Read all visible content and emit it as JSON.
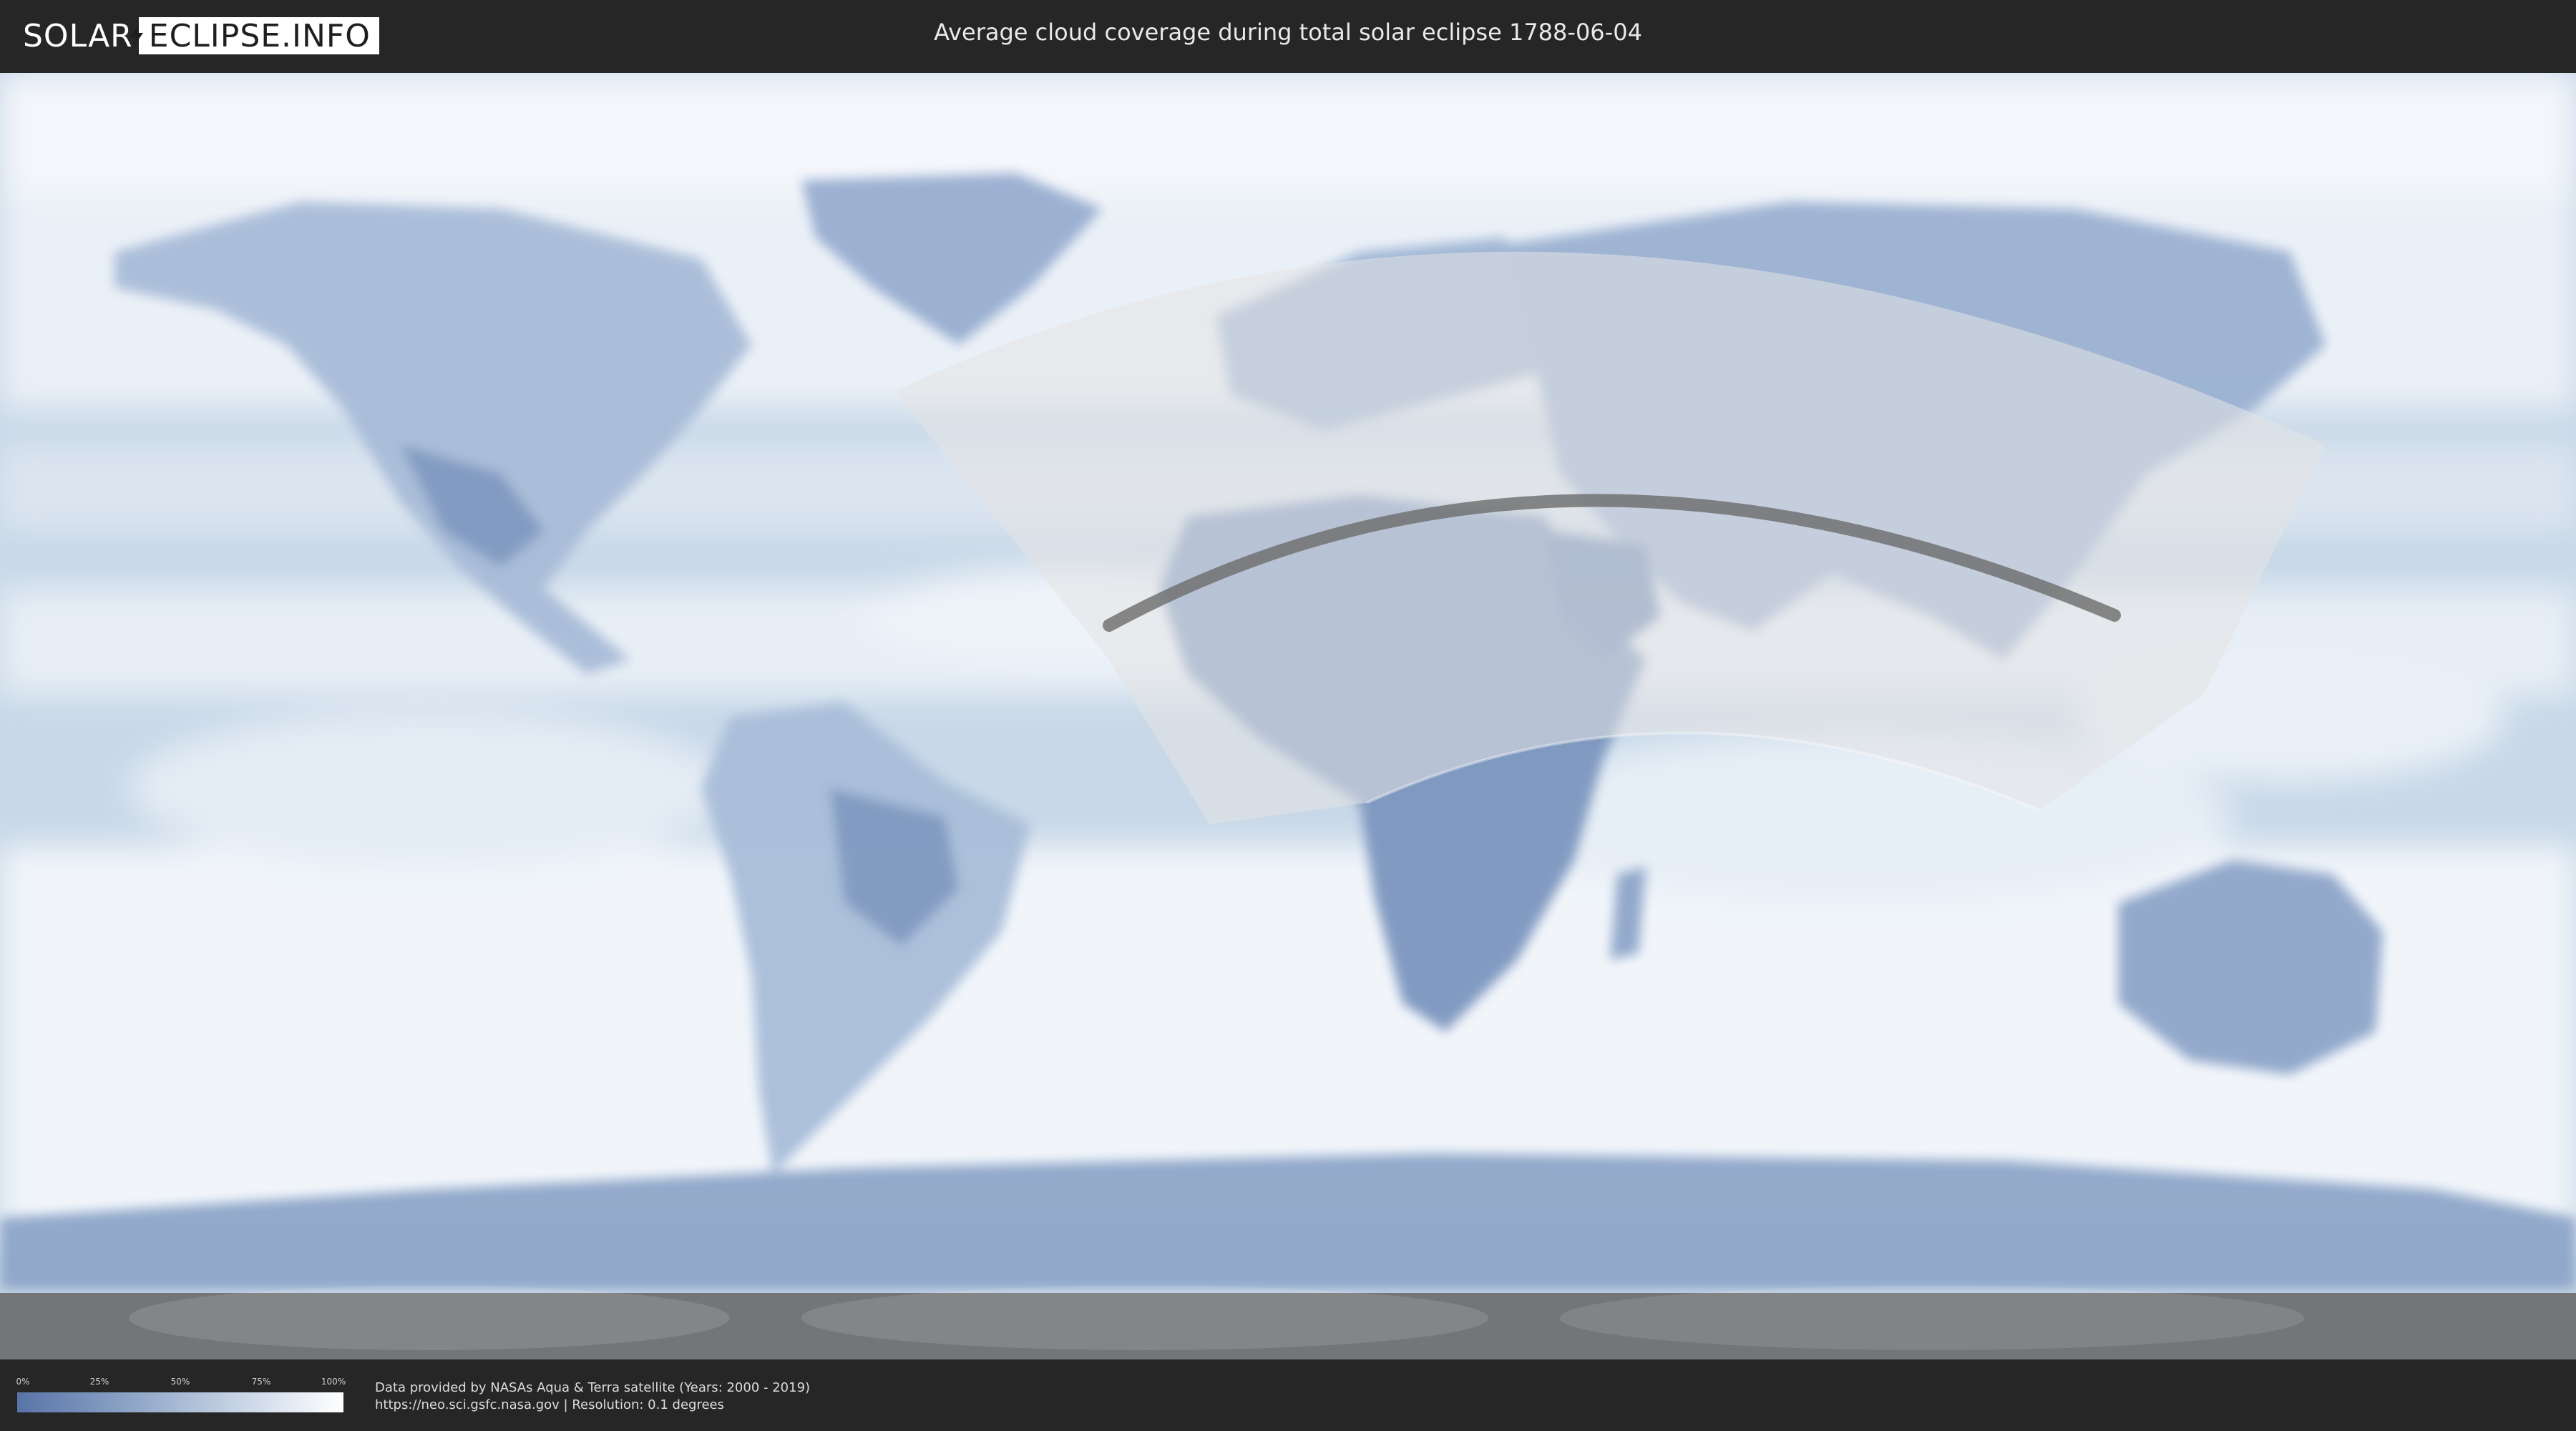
{
  "header": {
    "logo_left": "SOLAR",
    "logo_right": "ECLIPSE.INFO",
    "title": "Average cloud coverage during total solar eclipse 1788-06-04"
  },
  "legend": {
    "ticks": [
      "0%",
      "25%",
      "50%",
      "75%",
      "100%"
    ],
    "color_low": "#5873a7",
    "color_high": "#ffffff"
  },
  "footer": {
    "credit_line1": "Data provided by NASAs Aqua & Terra satellite (Years: 2000 - 2019)",
    "credit_line2": "https://neo.sci.gsfc.nasa.gov | Resolution: 0.1 degrees"
  },
  "map": {
    "ocean_color": "#c5d6e7",
    "cloud_color": "#f3f7fb",
    "land_color": "#7f98c0",
    "eclipse_zone_color": "#e3e3e3",
    "path_color": "#6b6b6b"
  }
}
